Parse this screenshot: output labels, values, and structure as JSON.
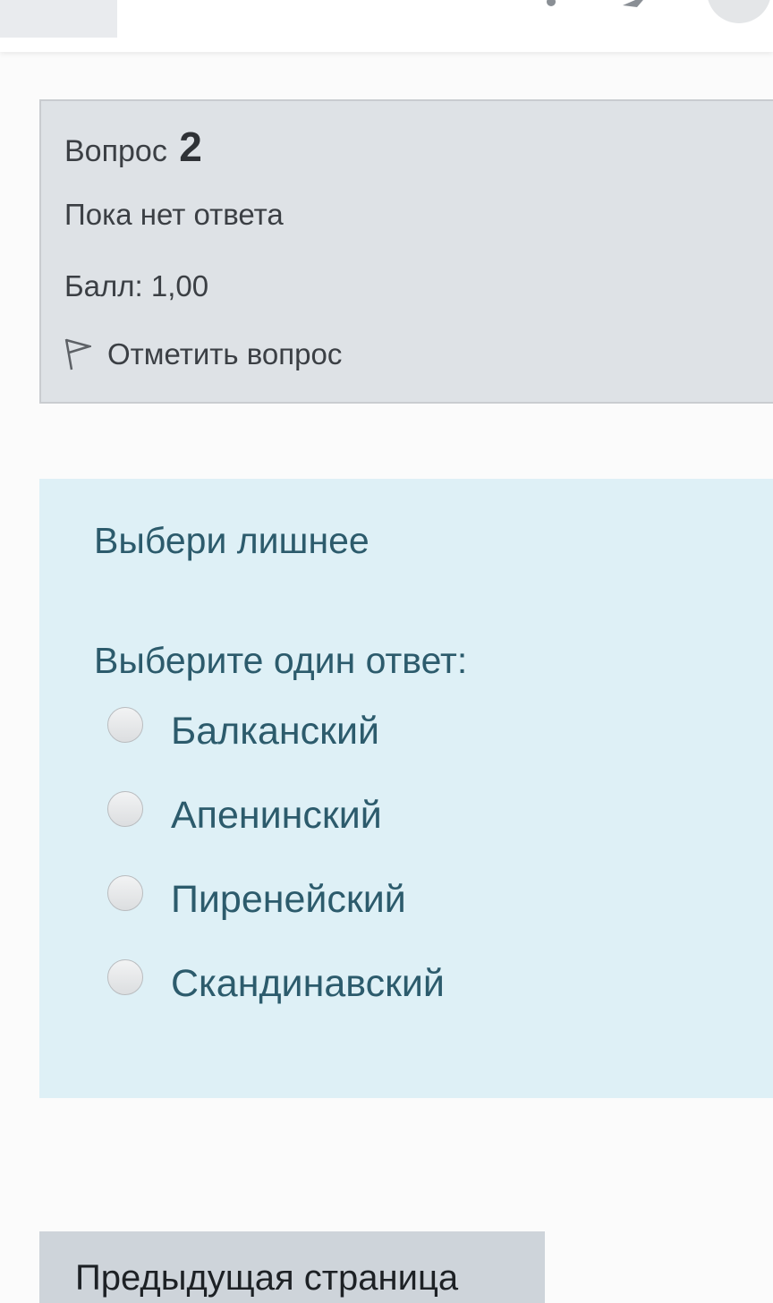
{
  "question_info": {
    "label": "Вопрос",
    "number": "2",
    "state": "Пока нет ответа",
    "grade": "Балл: 1,00",
    "flag_label": "Отметить вопрос"
  },
  "question": {
    "text": "Выбери лишнее",
    "prompt": "Выберите один ответ:",
    "answers": [
      {
        "label": "Балканский",
        "selected": false
      },
      {
        "label": "Апенинский",
        "selected": false
      },
      {
        "label": "Пиренейский",
        "selected": false
      },
      {
        "label": "Скандинавский",
        "selected": false
      }
    ]
  },
  "navigation": {
    "prev_label": "Предыдущая страница"
  },
  "colors": {
    "info_bg": "#dee2e6",
    "content_bg": "#def0f6",
    "content_text": "#2c5b6c",
    "button_bg": "#ced4da"
  }
}
